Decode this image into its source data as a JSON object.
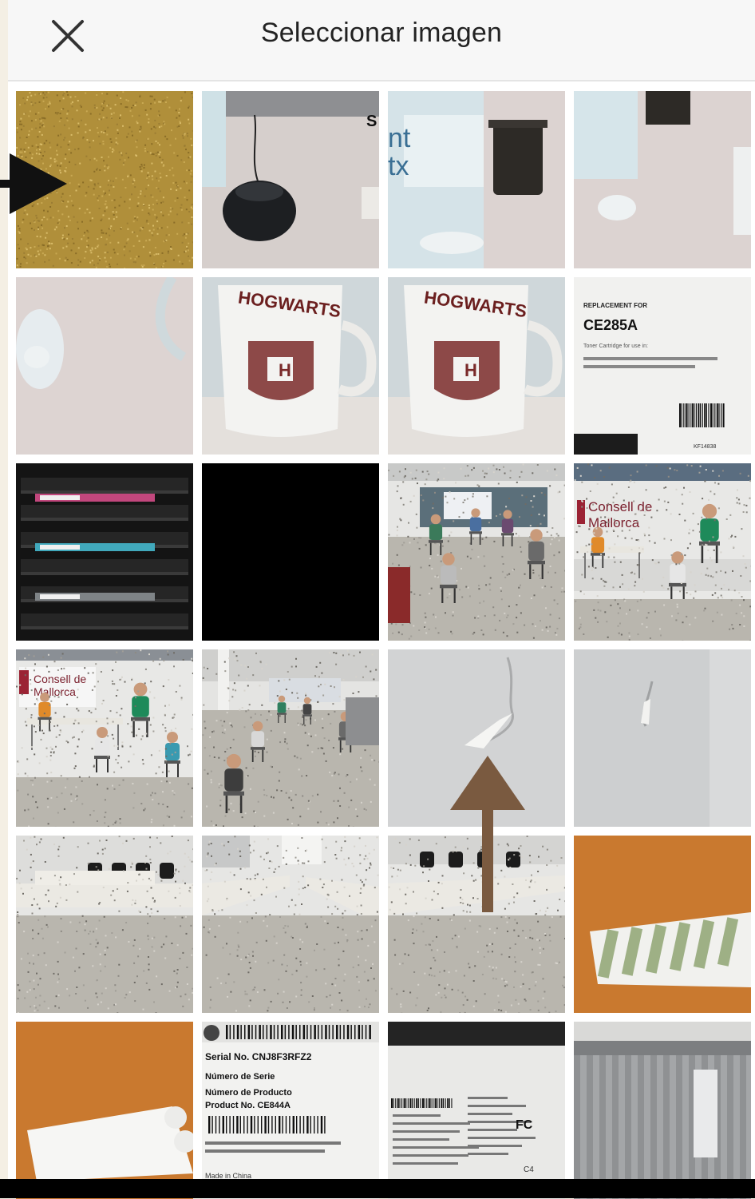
{
  "header": {
    "title": "Seleccionar imagen",
    "close_icon": "close-icon"
  },
  "tiles": [
    {
      "kind": "sand"
    },
    {
      "kind": "mouse",
      "text": "S"
    },
    {
      "kind": "bottle",
      "text": "nt",
      "text2": "tx"
    },
    {
      "kind": "bottle-corner"
    },
    {
      "kind": "blur-cup"
    },
    {
      "kind": "mug",
      "text": "HOGWARTS"
    },
    {
      "kind": "mug",
      "text": "HOGWARTS"
    },
    {
      "kind": "toner-box",
      "heading": "REPLACEMENT FOR",
      "model": "CE285A",
      "line1": "Toner Cartridge for use in:",
      "code": "KF14838"
    },
    {
      "kind": "toner-drawer"
    },
    {
      "kind": "black"
    },
    {
      "kind": "hall-people"
    },
    {
      "kind": "stage-talk",
      "banner": "Consell de",
      "banner2": "Mallorca"
    },
    {
      "kind": "stage-talk-wide",
      "banner": "Consell de",
      "banner2": "Mallorca"
    },
    {
      "kind": "hall-long"
    },
    {
      "kind": "wall-crack"
    },
    {
      "kind": "wall-crack-small"
    },
    {
      "kind": "tables-1"
    },
    {
      "kind": "tables-2"
    },
    {
      "kind": "tables-3"
    },
    {
      "kind": "tape-orange"
    },
    {
      "kind": "tape-white"
    },
    {
      "kind": "serial-label",
      "l1": "Serial No. CNJ8F3RFZ2",
      "l2": "Número de Serie",
      "l3": "Número de Producto",
      "l4": "Product No. CE844A",
      "l5": "Made in China"
    },
    {
      "kind": "spec-label",
      "l1": "FC",
      "l2": "C4"
    },
    {
      "kind": "curtain"
    }
  ],
  "colors": {
    "header_bg": "#f7f7f7",
    "page_bg": "#f4efe4",
    "arrow_black": "#111111",
    "arrow_brown": "#7a5a40"
  },
  "annotations": [
    {
      "kind": "arrow-right",
      "color": "#111111"
    },
    {
      "kind": "arrow-up",
      "color": "#7a5a40"
    }
  ]
}
